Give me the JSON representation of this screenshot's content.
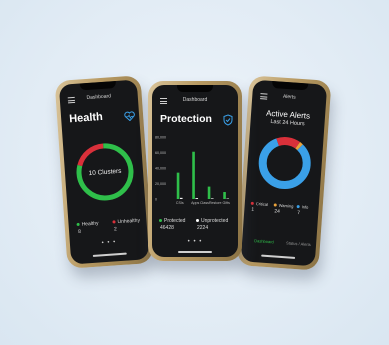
{
  "phones": {
    "health": {
      "nav_title": "Dashboard",
      "title": "Health",
      "center_label": "10 Clusters",
      "healthy_label": "Healthy",
      "healthy_count": "8",
      "unhealthy_label": "Unhealthy",
      "unhealthy_count": "2",
      "healthy_color": "#2fbf4a",
      "unhealthy_color": "#d9303a",
      "pager": "• • •"
    },
    "protection": {
      "nav_title": "Dashboard",
      "title": "Protection",
      "protected_label": "Protected",
      "protected_count": "46428",
      "unprotected_label": "Unprotected",
      "unprotected_count": "2224",
      "bar_color": "#2fbf4a",
      "pager": "• • •",
      "chart_data": {
        "type": "bar",
        "categories": [
          "CSIs",
          "Apps",
          "ClassRestore",
          "Gifts"
        ],
        "series": [
          {
            "values": [
              34000,
              61000,
              16000,
              9000
            ]
          },
          {
            "values": [
              1500,
              1200,
              800,
              600
            ]
          }
        ],
        "y_ticks": [
          "80,000",
          "60,000",
          "40,000",
          "20,000",
          "0"
        ],
        "ylim": [
          0,
          80000
        ]
      }
    },
    "alerts": {
      "nav_title": "Alerts",
      "title": "Active Alerts",
      "subtitle": "Last 24 Hours",
      "critical_label": "Critical",
      "critical_count": "1",
      "warning_label": "Warning",
      "warning_count": "24",
      "info_label": "Info",
      "info_count": "7",
      "critical_color": "#d9303a",
      "warning_color": "#e9a23b",
      "info_color": "#3aa0e8",
      "tab_active": "Dashboard",
      "tab_inactive": "Status / Alerts"
    }
  }
}
